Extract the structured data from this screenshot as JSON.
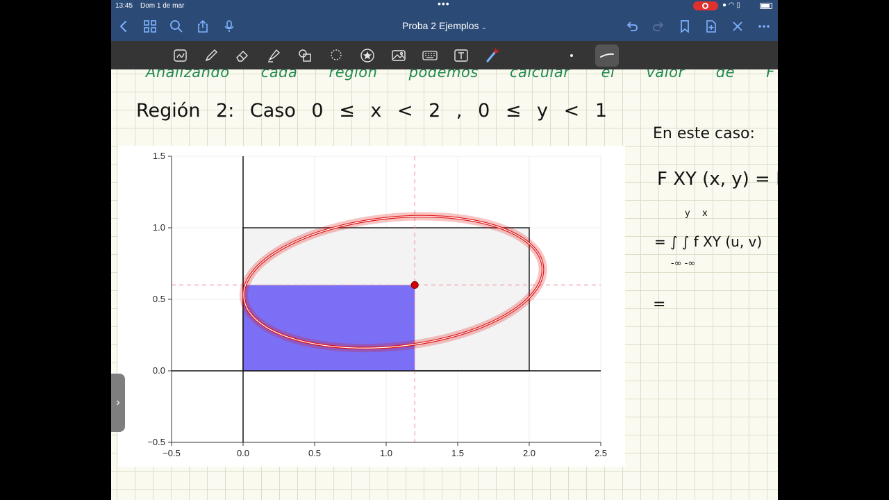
{
  "status": {
    "time": "13:45",
    "date": "Dom 1 de mar",
    "dots": "•••"
  },
  "nav": {
    "title": "Proba 2 Ejemplos",
    "icons": [
      "back-icon",
      "grid-icon",
      "search-icon",
      "share-icon",
      "mic-icon",
      "undo-icon",
      "redo-icon",
      "bookmark-icon",
      "add-page-icon",
      "close-icon",
      "more-icon"
    ]
  },
  "toolbar": {
    "tools": [
      "lasso-text-icon",
      "pen-icon",
      "eraser-icon",
      "highlighter-icon",
      "shapes-icon",
      "lasso-icon",
      "sticker-icon",
      "image-icon",
      "keyboard-icon",
      "textbox-icon",
      "laser-pointer-icon"
    ],
    "active_tool": "laser-pointer",
    "colors": {
      "laser": "#e02020",
      "accent": "#7fb3ff",
      "toolbar_bg": "#353535",
      "nav_bg": "#2b4a76"
    }
  },
  "notes": {
    "green_line": "Analizando cada región podemos calcular el valor de F XY (x,y).",
    "region_line": "Región 2: Caso 0 ≤ x < 2 , 0 ≤ y < 1",
    "side_1": "En este caso:",
    "side_2": "F XY (x, y) = P",
    "side_3": "= ∫ ∫ f XY (u, v)",
    "side_3_upper_y": "y",
    "side_3_upper_x": "x",
    "side_3_lower": "-∞ -∞",
    "side_4": "="
  },
  "chart_data": {
    "type": "area",
    "xlim": [
      -0.5,
      2.5
    ],
    "ylim": [
      -0.5,
      1.5
    ],
    "xticks": [
      "−0.5",
      "0.0",
      "0.5",
      "1.0",
      "1.5",
      "2.0",
      "2.5"
    ],
    "yticks": [
      "−0.5",
      "0.0",
      "0.5",
      "1.0",
      "1.5"
    ],
    "xtick_values": [
      -0.5,
      0.0,
      0.5,
      1.0,
      1.5,
      2.0,
      2.5
    ],
    "ytick_values": [
      -0.5,
      0.0,
      0.5,
      1.0,
      1.5
    ],
    "support_rect": {
      "x0": 0,
      "x1": 2,
      "y0": 0,
      "y1": 1,
      "fill": "#f3f3f3"
    },
    "cdf_rect": {
      "x0": 0,
      "x1": 1.2,
      "y0": 0,
      "y1": 0.6,
      "fill": "#7b6ff5"
    },
    "point": {
      "x": 1.2,
      "y": 0.6,
      "color": "#d90000"
    },
    "guide_color": "#f0a0a8",
    "grid": true,
    "annotation_ellipse": {
      "cx": 1.05,
      "cy": 0.62,
      "rx": 1.05,
      "ry": 0.45,
      "color": "#e01010"
    }
  }
}
